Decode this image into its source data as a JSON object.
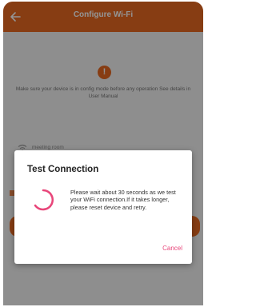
{
  "header": {
    "title": "Configure Wi-Fi"
  },
  "main": {
    "notice": "Make sure your device is in config mode before any operation See details in User Manual",
    "wifi_name": "meeting room"
  },
  "dialog": {
    "title": "Test Connection",
    "message": "Please wait about 30 seconds as we test your WiFi connection.If it takes longer, please reset device and retry.",
    "cancel_label": "Cancel"
  },
  "colors": {
    "accent": "#e86a22",
    "spinner": "#e8467a",
    "cancel": "#e8467a"
  }
}
